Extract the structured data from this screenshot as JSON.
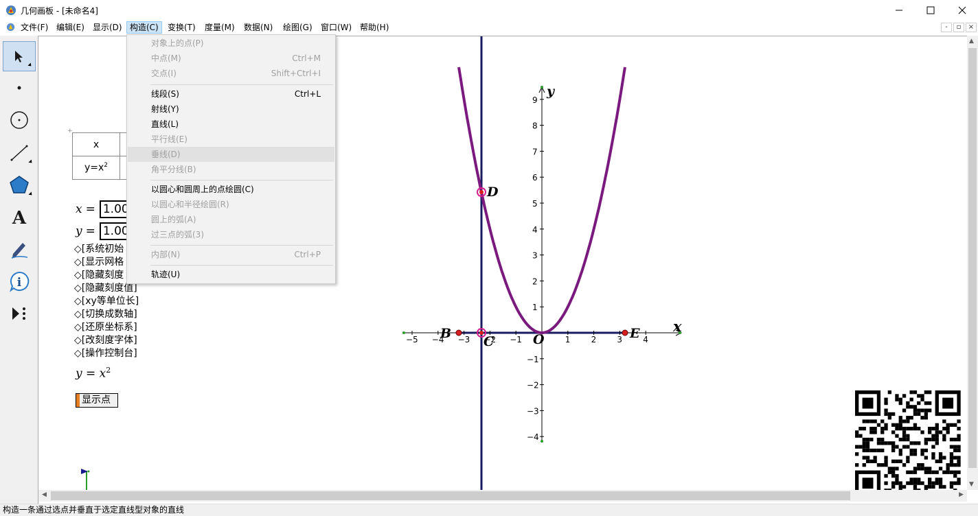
{
  "window": {
    "title": "几何画板 - [未命名4]",
    "icons": {
      "app": "geometers-sketchpad-icon",
      "minimize": "minimize-icon",
      "maximize": "maximize-icon",
      "close": "close-icon"
    }
  },
  "menubar": {
    "items": [
      "文件(F)",
      "编辑(E)",
      "显示(D)",
      "构造(C)",
      "变换(T)",
      "度量(M)",
      "数据(N)",
      "绘图(G)",
      "窗口(W)",
      "帮助(H)"
    ],
    "active": "构造(C)",
    "mdi_buttons": [
      "-",
      "▫",
      "×"
    ]
  },
  "toolbox": {
    "tools": [
      "arrow-select-tool",
      "point-tool",
      "compass-tool",
      "straightedge-tool",
      "polygon-tool",
      "text-tool",
      "marker-tool",
      "information-tool",
      "custom-tool"
    ],
    "selected": "arrow-select-tool"
  },
  "construct_menu": {
    "items": [
      {
        "label": "对象上的点(P)",
        "shortcut": "",
        "enabled": false
      },
      {
        "label": "中点(M)",
        "shortcut": "Ctrl+M",
        "enabled": false
      },
      {
        "label": "交点(I)",
        "shortcut": "Shift+Ctrl+I",
        "enabled": false
      },
      {
        "label": "线段(S)",
        "shortcut": "Ctrl+L",
        "enabled": true
      },
      {
        "label": "射线(Y)",
        "shortcut": "",
        "enabled": true
      },
      {
        "label": "直线(L)",
        "shortcut": "",
        "enabled": true
      },
      {
        "label": "平行线(E)",
        "shortcut": "",
        "enabled": false
      },
      {
        "label": "垂线(D)",
        "shortcut": "",
        "enabled": false,
        "hover": true
      },
      {
        "label": "角平分线(B)",
        "shortcut": "",
        "enabled": false
      },
      {
        "label": "以圆心和圆周上的点绘圆(C)",
        "shortcut": "",
        "enabled": true
      },
      {
        "label": "以圆心和半径绘圆(R)",
        "shortcut": "",
        "enabled": false
      },
      {
        "label": "圆上的弧(A)",
        "shortcut": "",
        "enabled": false
      },
      {
        "label": "过三点的弧(3)",
        "shortcut": "",
        "enabled": false
      },
      {
        "label": "内部(N)",
        "shortcut": "Ctrl+P",
        "enabled": false
      },
      {
        "label": "轨迹(U)",
        "shortcut": "",
        "enabled": true
      }
    ]
  },
  "table": {
    "row1_header": "x",
    "row2_header": "y=x",
    "row2_sup": "2"
  },
  "params": {
    "x": {
      "name": "x",
      "eq": "=",
      "value": "1.00"
    },
    "y": {
      "name": "y",
      "eq": "=",
      "value": "1.00"
    }
  },
  "actions": [
    "◇[系统初始",
    "◇[显示网格",
    "◇[隐藏刻度",
    "◇[隐藏刻度值]",
    "◇[xy等单位长]",
    "◇[切换成数轴]",
    "◇[还原坐标系]",
    "◇[改刻度字体]",
    "◇[操作控制台]"
  ],
  "formula": {
    "lhs": "y",
    "eq": " = ",
    "var": "x",
    "exp": "2"
  },
  "show_points_button": "显示点",
  "graph": {
    "axis_labels": {
      "x": "x",
      "y": "y",
      "origin": "O"
    },
    "x_ticks": [
      "−5",
      "−4",
      "−3",
      "−2",
      "−1",
      "1",
      "2",
      "3",
      "4"
    ],
    "y_ticks": [
      "9",
      "8",
      "7",
      "6",
      "5",
      "4",
      "3",
      "2",
      "1",
      "−1",
      "−2",
      "−3",
      "−4"
    ],
    "points": {
      "B": "B",
      "C": "C",
      "D": "D",
      "E": "E"
    },
    "colors": {
      "parabola": "#7b1a7e",
      "vertical_line": "#1a1a5e",
      "point_fill": "#d81e1e",
      "axis": "#000000"
    }
  },
  "statusbar": {
    "text": "构造一条通过选点并垂直于选定直线型对象的直线"
  },
  "qr_code": "qr-code-image"
}
